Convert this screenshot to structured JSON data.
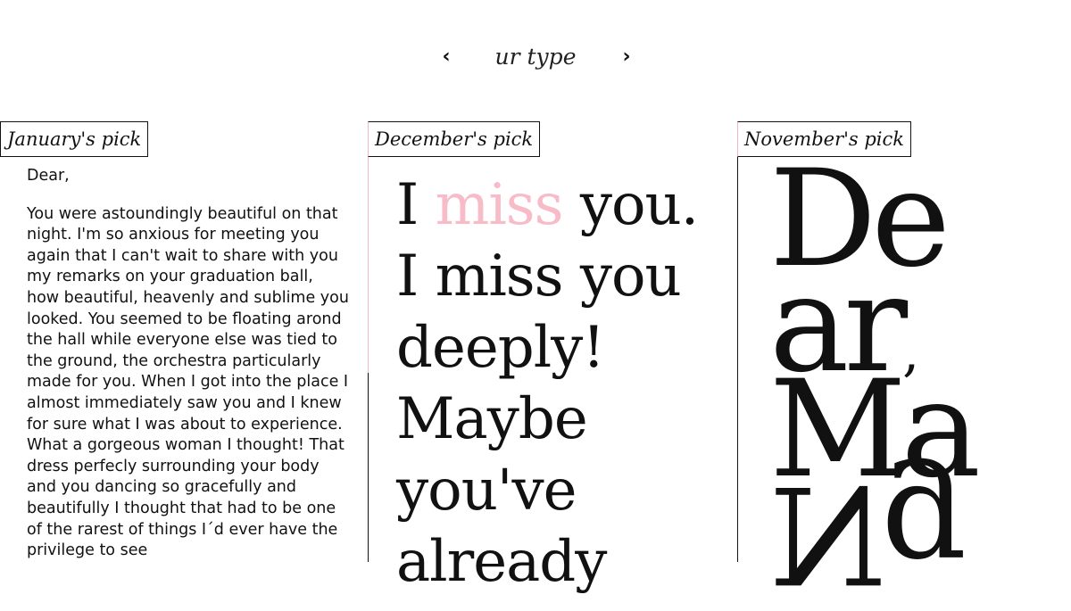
{
  "nav": {
    "prev_icon": "chevron-left-icon",
    "next_icon": "chevron-right-icon",
    "prev_glyph": "‹",
    "next_glyph": "›",
    "title": "ur type"
  },
  "columns": [
    {
      "label": "January's pick",
      "paragraphs": [
        "Dear,",
        "You were astoundingly beautiful on that night. I'm so anxious for meeting you again that I can't wait to share with you my remarks on your graduation ball, how beautiful, heavenly and sublime you looked. You seemed to be floating arond the hall while everyone else was tied to the ground, the orchestra particularly made for you. When I got into the place I almost immediately saw you and I knew for sure what I was about to experience. What a gorgeous woman I thought! That dress perfecly surrounding your body and you dancing so gracefully and beautifully I thought that had to be one of the rarest of things I´d ever have the privilege to see"
      ]
    },
    {
      "label": "December's pick",
      "lines": [
        "I",
        "miss",
        "you.",
        "I miss you",
        "deeply!",
        "Maybe",
        "you've",
        "already"
      ],
      "accent_color": "#f7bcc8"
    },
    {
      "label": "November's pick",
      "rows": [
        "De",
        "ar",
        ",",
        "Ma",
        "Ng"
      ]
    }
  ]
}
